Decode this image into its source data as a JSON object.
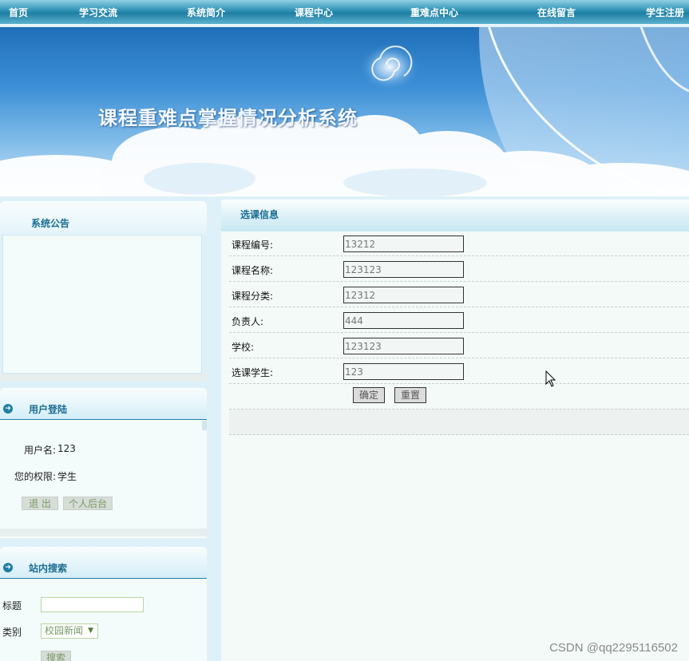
{
  "nav": [
    {
      "label": "首页"
    },
    {
      "label": "学习交流"
    },
    {
      "label": "系统简介"
    },
    {
      "label": "课程中心"
    },
    {
      "label": "重难点中心"
    },
    {
      "label": "在线留言"
    },
    {
      "label": "学生注册"
    }
  ],
  "banner": {
    "title": "课程重难点掌握情况分析系统"
  },
  "notice": {
    "title": "系统公告"
  },
  "login": {
    "title": "用户登陆",
    "username_label": "用户名:",
    "username_value": "123",
    "role_label": "您的权限:",
    "role_value": "学生",
    "logout_label": "退 出",
    "backend_label": "个人后台"
  },
  "search": {
    "title": "站内搜索",
    "title_label": "标题",
    "title_value": "",
    "category_label": "类别",
    "category_value": "校园新闻",
    "submit_label": "搜索"
  },
  "main": {
    "title": "选课信息",
    "fields": [
      {
        "label": "课程编号:",
        "value": "13212"
      },
      {
        "label": "课程名称:",
        "value": "123123"
      },
      {
        "label": "课程分类:",
        "value": "12312"
      },
      {
        "label": "负责人:",
        "value": "444"
      },
      {
        "label": "学校:",
        "value": "123123"
      },
      {
        "label": "选课学生:",
        "value": "123"
      }
    ],
    "confirm_label": "确定",
    "reset_label": "重置"
  },
  "watermark": "CSDN @qq2295116502",
  "colors": {
    "accent": "#1a6d93",
    "nav": "#1f7ea3",
    "button_text": "#7a9a6a"
  }
}
